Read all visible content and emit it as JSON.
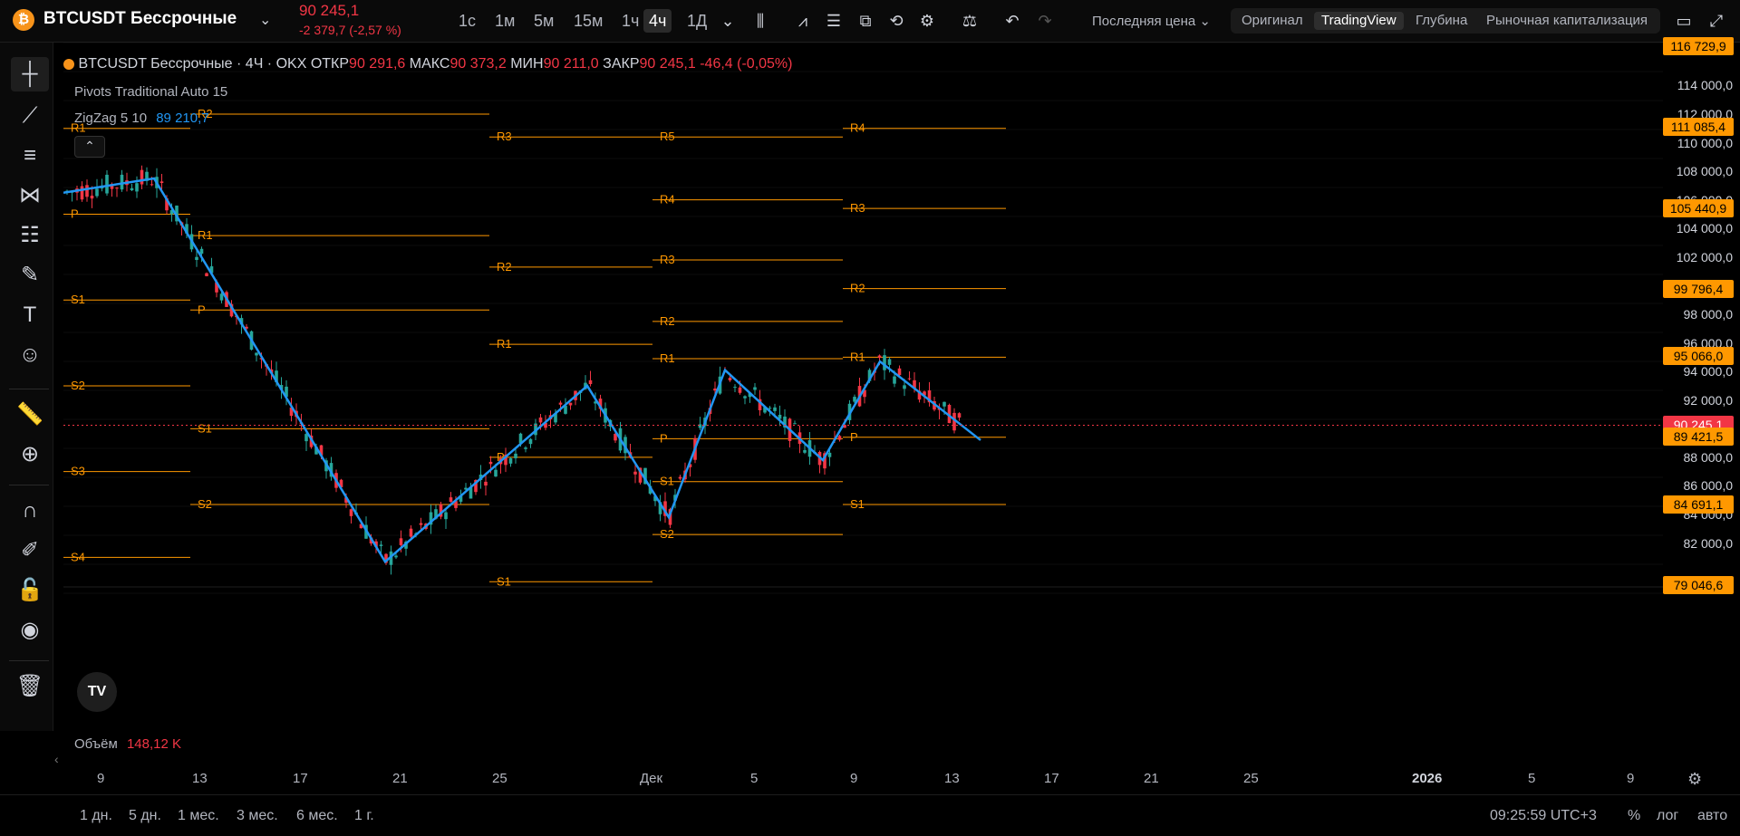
{
  "header": {
    "coin_glyph": "₿",
    "symbol": "BTCUSDT Бессрочные",
    "last_price": "90 245,1",
    "change": "-2 379,7 (-2,57 %)",
    "timeframes": [
      "1с",
      "1м",
      "5м",
      "15м",
      "1ч",
      "4ч",
      "1Д"
    ],
    "active_timeframe": "4ч",
    "price_source": "Последняя цена",
    "views": [
      "Оригинал",
      "TradingView",
      "Глубина",
      "Рыночная капитализация"
    ],
    "active_view": "TradingView"
  },
  "legend": {
    "title": "BTCUSDT Бессрочные · 4Ч · OKX",
    "open_label": "ОТКР",
    "open": "90 291,6",
    "high_label": "МАКС",
    "high": "90 373,2",
    "low_label": "МИН",
    "low": "90 211,0",
    "close_label": "ЗАКР",
    "close": "90 245,1",
    "change": "-46,4 (-0,05%)",
    "indicator_pivots": "Pivots Traditional Auto 15",
    "indicator_zigzag": "ZigZag 5 10",
    "zigzag_value": "89 210,7",
    "volume_label": "Объём",
    "volume_value": "148,12 K"
  },
  "price_axis": {
    "ticks": [
      "114 000,0",
      "112 000,0",
      "110 000,0",
      "108 000,0",
      "106 000,0",
      "104 000,0",
      "102 000,0",
      "100 000,0",
      "98 000,0",
      "96 000,0",
      "94 000,0",
      "92 000,0",
      "88 000,0",
      "86 000,0",
      "84 000,0",
      "82 000,0"
    ],
    "tags": [
      {
        "value": "116 729,9",
        "price": 116729.9,
        "color": "#ff9800"
      },
      {
        "value": "111 085,4",
        "price": 111085.4,
        "color": "#ff9800"
      },
      {
        "value": "105 440,9",
        "price": 105440.9,
        "color": "#ff9800"
      },
      {
        "value": "99 796,4",
        "price": 99796.4,
        "color": "#ff9800"
      },
      {
        "value": "95 066,0",
        "price": 95066.0,
        "color": "#ff9800"
      },
      {
        "value": "90 245,1",
        "price": 90245.1,
        "color": "#f23645"
      },
      {
        "value": "89 421,5",
        "price": 89421.5,
        "color": "#ff9800"
      },
      {
        "value": "84 691,1",
        "price": 84691.1,
        "color": "#ff9800"
      },
      {
        "value": "79 046,6",
        "price": 79046.6,
        "color": "#ff9800"
      }
    ]
  },
  "time_axis": {
    "labels": [
      "9",
      "13",
      "17",
      "21",
      "25",
      "Дек",
      "5",
      "9",
      "13",
      "17",
      "21",
      "25",
      "2026",
      "5",
      "9"
    ]
  },
  "bottom": {
    "ranges": [
      "1 дн.",
      "5 дн.",
      "1 мес.",
      "3 мес.",
      "6 мес.",
      "1 г."
    ],
    "clock": "09:25:59 UTC+3",
    "percent": "%",
    "log": "лог",
    "auto": "авто"
  },
  "colors": {
    "up": "#26a69a",
    "down": "#f23645",
    "pivot": "#ff9800",
    "zigzag": "#2196f3"
  },
  "chart_data": {
    "type": "candlestick",
    "zigzag": [
      {
        "price": 106500
      },
      {
        "price": 107500
      },
      {
        "price": 80700
      },
      {
        "price": 93000
      },
      {
        "price": 83800
      },
      {
        "price": 94100
      },
      {
        "price": 87800
      },
      {
        "price": 94700
      },
      {
        "price": 89200
      }
    ],
    "pivot_periods": [
      {
        "levels": [
          {
            "name": "R2",
            "price": null
          },
          {
            "name": "R1",
            "price": 111000
          },
          {
            "name": "P",
            "price": 105000
          },
          {
            "name": "S1",
            "price": 99000
          },
          {
            "name": "S2",
            "price": 93000
          },
          {
            "name": "S3",
            "price": 87000
          },
          {
            "name": "S4",
            "price": 81000
          }
        ]
      },
      {
        "levels": [
          {
            "name": "R2",
            "price": 112000
          },
          {
            "name": "R1",
            "price": 103500
          },
          {
            "name": "P",
            "price": 98300
          },
          {
            "name": "S1",
            "price": 90000
          },
          {
            "name": "S2",
            "price": 84700
          }
        ]
      },
      {
        "levels": [
          {
            "name": "R3",
            "price": 110400
          },
          {
            "name": "R2",
            "price": 101300
          },
          {
            "name": "R1",
            "price": 95900
          },
          {
            "name": "P",
            "price": 88000
          },
          {
            "name": "S1",
            "price": 79300
          }
        ]
      },
      {
        "levels": [
          {
            "name": "R5",
            "price": 110400
          },
          {
            "name": "R4",
            "price": 106000
          },
          {
            "name": "R3",
            "price": 101800
          },
          {
            "name": "R2",
            "price": 97500
          },
          {
            "name": "R1",
            "price": 94900
          },
          {
            "name": "P",
            "price": 89300
          },
          {
            "name": "S1",
            "price": 86300
          },
          {
            "name": "S2",
            "price": 82600
          }
        ]
      },
      {
        "levels": [
          {
            "name": "R4",
            "price": 111000
          },
          {
            "name": "R3",
            "price": 105400
          },
          {
            "name": "R2",
            "price": 99800
          },
          {
            "name": "R1",
            "price": 95000
          },
          {
            "name": "P",
            "price": 89400
          },
          {
            "name": "S1",
            "price": 84700
          }
        ]
      }
    ],
    "ylim": [
      79000,
      117000
    ]
  }
}
